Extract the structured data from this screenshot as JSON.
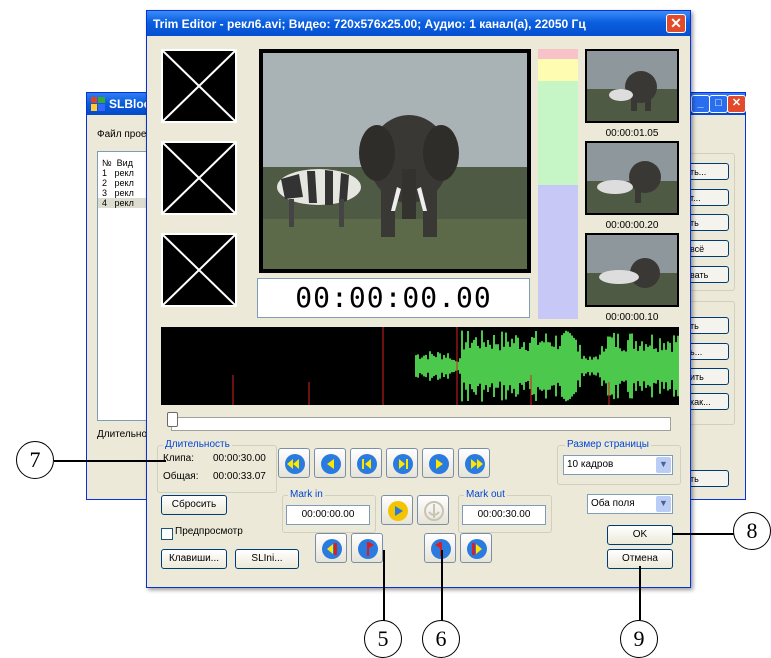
{
  "background_window": {
    "title": "SLBloc",
    "project_label": "Файл прое",
    "list_header_num": "№",
    "list_header_name": "Вид",
    "rows": [
      {
        "num": "1",
        "name": "рекл"
      },
      {
        "num": "2",
        "name": "рекл"
      },
      {
        "num": "3",
        "name": "рекл"
      },
      {
        "num": "4",
        "name": "рекл"
      }
    ],
    "duration_label": "Длительно",
    "right_buttons": [
      "ть...",
      "т...",
      "ть",
      "всё",
      "вать",
      "ть",
      "ь...",
      "ить",
      "как...",
      "ть"
    ]
  },
  "dialog": {
    "title": "Trim Editor - рекл6.avi; Видео: 720x576x25.00; Аудио: 1 канал(а), 22050 Гц",
    "timecode": "00:00:00.00",
    "thumbnails": [
      "00:00:01.05",
      "00:00:00.20",
      "00:00:00.10"
    ],
    "duration_group": {
      "title": "Длительность",
      "clip_label": "Клипа:",
      "clip_value": "00:00:30.00",
      "total_label": "Общая:",
      "total_value": "00:00:33.07"
    },
    "reset_button": "Сбросить",
    "preview_label": "Предпросмотр",
    "keys_button": "Клавиши...",
    "slini_button": "SLIni...",
    "mark_in": {
      "label": "Mark in",
      "value": "00:00:00.00"
    },
    "mark_out": {
      "label": "Mark out",
      "value": "00:00:30.00"
    },
    "page_size": {
      "label": "Размер страницы",
      "value": "10 кадров"
    },
    "fields_select": "Оба поля",
    "ok_button": "OK",
    "cancel_button": "Отмена"
  },
  "callouts": [
    "7",
    "8",
    "5",
    "6",
    "9"
  ],
  "colors": {
    "titlebar": "#0b5fe0",
    "dialog_bg": "#ece9d8",
    "nav_button_blue": "#2a7be0",
    "play_yellow": "#f5c400",
    "marker_red": "#d92020",
    "waveform_green": "#4cc94c",
    "level_pink": "#f7c3c8",
    "level_yellow": "#fdfcb0",
    "level_green": "#c6f5c6",
    "level_lavender": "#c8c8f7"
  },
  "icons": [
    "x-placeholder-icon",
    "skip-start-icon",
    "prev-page-icon",
    "prev-frame-icon",
    "next-frame-icon",
    "next-page-icon",
    "skip-end-icon",
    "play-icon",
    "anchor-icon",
    "go-mark-in-icon",
    "set-mark-in-icon",
    "set-mark-out-icon",
    "go-mark-out-icon",
    "close-icon"
  ]
}
